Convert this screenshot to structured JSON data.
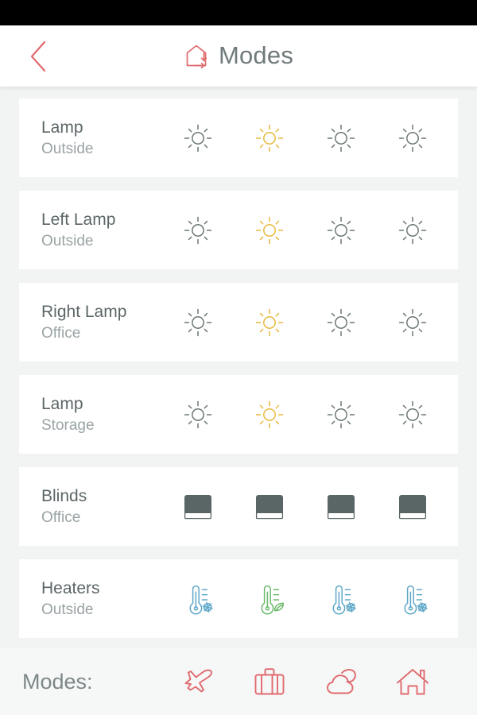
{
  "colors": {
    "accent_red": "#e06a6e",
    "text_primary": "#5c6667",
    "text_secondary": "#9aa3a4",
    "page_background": "#f2f4f4",
    "card_background": "#ffffff",
    "status_bar": "#000000",
    "icon_gray": "#6c7778",
    "icon_yellow": "#e8b93f",
    "icon_blue": "#5fa8c8",
    "icon_green": "#6cb86c",
    "blind_fill": "#5a6566"
  },
  "header": {
    "title": "Modes",
    "icon": "house-arrow-in-icon",
    "back_icon": "chevron-left-icon"
  },
  "columns": [
    {
      "index": 1
    },
    {
      "index": 2
    },
    {
      "index": 3
    },
    {
      "index": 4
    }
  ],
  "rows": [
    {
      "name": "Lamp",
      "place": "Outside",
      "device_type": "light",
      "cells": [
        {
          "icon": "sun-icon",
          "state": "off",
          "color": "#6c7778"
        },
        {
          "icon": "sun-icon",
          "state": "on",
          "color": "#e8b93f"
        },
        {
          "icon": "sun-icon",
          "state": "off",
          "color": "#6c7778"
        },
        {
          "icon": "sun-icon",
          "state": "off",
          "color": "#6c7778"
        }
      ]
    },
    {
      "name": "Left Lamp",
      "place": "Outside",
      "device_type": "light",
      "cells": [
        {
          "icon": "sun-icon",
          "state": "off",
          "color": "#6c7778"
        },
        {
          "icon": "sun-icon",
          "state": "on",
          "color": "#e8b93f"
        },
        {
          "icon": "sun-icon",
          "state": "off",
          "color": "#6c7778"
        },
        {
          "icon": "sun-icon",
          "state": "off",
          "color": "#6c7778"
        }
      ]
    },
    {
      "name": "Right Lamp",
      "place": "Office",
      "device_type": "light",
      "cells": [
        {
          "icon": "sun-icon",
          "state": "off",
          "color": "#6c7778"
        },
        {
          "icon": "sun-icon",
          "state": "on",
          "color": "#e8b93f"
        },
        {
          "icon": "sun-icon",
          "state": "off",
          "color": "#6c7778"
        },
        {
          "icon": "sun-icon",
          "state": "off",
          "color": "#6c7778"
        }
      ]
    },
    {
      "name": "Lamp",
      "place": "Storage",
      "device_type": "light",
      "cells": [
        {
          "icon": "sun-icon",
          "state": "off",
          "color": "#6c7778"
        },
        {
          "icon": "sun-icon",
          "state": "on",
          "color": "#e8b93f"
        },
        {
          "icon": "sun-icon",
          "state": "off",
          "color": "#6c7778"
        },
        {
          "icon": "sun-icon",
          "state": "off",
          "color": "#6c7778"
        }
      ]
    },
    {
      "name": "Blinds",
      "place": "Office",
      "device_type": "blind",
      "cells": [
        {
          "icon": "blind-closed-icon",
          "state": "closed",
          "color": "#5a6566"
        },
        {
          "icon": "blind-closed-icon",
          "state": "closed",
          "color": "#5a6566"
        },
        {
          "icon": "blind-closed-icon",
          "state": "closed",
          "color": "#5a6566"
        },
        {
          "icon": "blind-closed-icon",
          "state": "closed",
          "color": "#5a6566"
        }
      ]
    },
    {
      "name": "Heaters",
      "place": "Outside",
      "device_type": "heater",
      "cells": [
        {
          "icon": "thermometer-snowflake-icon",
          "state": "frost",
          "color": "#5fa8c8"
        },
        {
          "icon": "thermometer-leaf-icon",
          "state": "eco",
          "color": "#6cb86c"
        },
        {
          "icon": "thermometer-snowflake-icon",
          "state": "frost",
          "color": "#5fa8c8"
        },
        {
          "icon": "thermometer-snowflake-icon",
          "state": "frost",
          "color": "#5fa8c8"
        }
      ]
    }
  ],
  "modes_bar": {
    "label": "Modes:",
    "buttons": [
      {
        "icon": "airplane-icon",
        "name": "away-mode",
        "color": "#e06a6e"
      },
      {
        "icon": "suitcase-icon",
        "name": "holiday-mode",
        "color": "#e06a6e"
      },
      {
        "icon": "cloud-moon-icon",
        "name": "night-mode",
        "color": "#e06a6e"
      },
      {
        "icon": "house-icon",
        "name": "home-mode",
        "color": "#e06a6e"
      }
    ]
  }
}
